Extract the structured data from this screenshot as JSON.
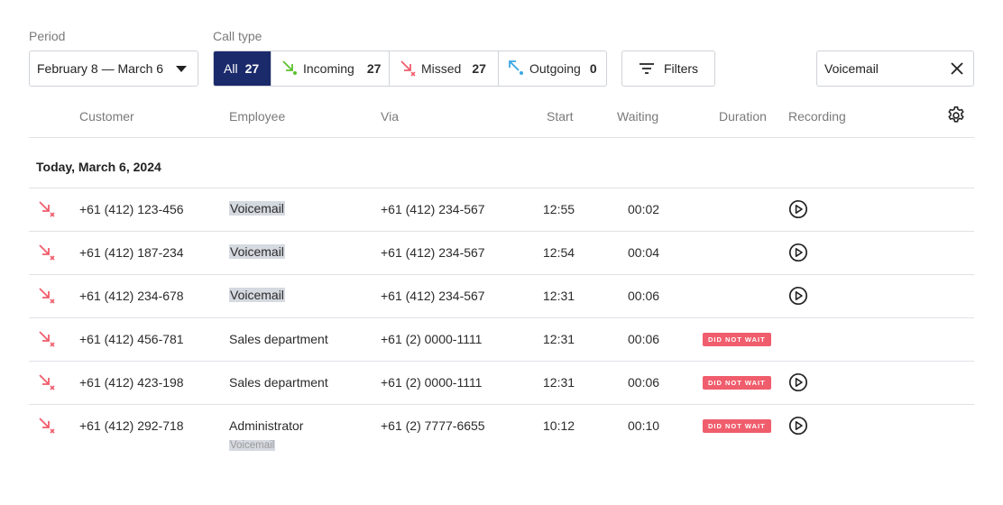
{
  "filters": {
    "period_label": "Period",
    "period_value": "February 8 — March 6",
    "call_type_label": "Call type",
    "call_types": [
      {
        "label": "All",
        "count": "27",
        "active": true,
        "icon": null
      },
      {
        "label": "Incoming",
        "count": "27",
        "active": false,
        "icon": "incoming-call-icon"
      },
      {
        "label": "Missed",
        "count": "27",
        "active": false,
        "icon": "missed-call-icon"
      },
      {
        "label": "Outgoing",
        "count": "0",
        "active": false,
        "icon": "outgoing-call-icon"
      }
    ],
    "filters_button": "Filters",
    "search_value": "Voicemail"
  },
  "table": {
    "headers": {
      "customer": "Customer",
      "employee": "Employee",
      "via": "Via",
      "start": "Start",
      "waiting": "Waiting",
      "duration": "Duration",
      "recording": "Recording"
    },
    "day_title": "Today, March 6, 2024",
    "rows": [
      {
        "customer": "+61 (412) 123-456",
        "employee": "Voicemail",
        "via": "+61 (412) 234-567",
        "start": "12:55",
        "waiting": "00:02",
        "badge": "",
        "recording": true
      },
      {
        "customer": "+61 (412) 187-234",
        "employee": "Voicemail",
        "via": "+61 (412) 234-567",
        "start": "12:54",
        "waiting": "00:04",
        "badge": "",
        "recording": true
      },
      {
        "customer": "+61 (412) 234-678",
        "employee": "Voicemail",
        "via": "+61 (412) 234-567",
        "start": "12:31",
        "waiting": "00:06",
        "badge": "",
        "recording": true
      },
      {
        "customer": "+61 (412) 456-781",
        "employee": "Sales department",
        "via": "+61 (2) 0000-1111",
        "start": "12:31",
        "waiting": "00:06",
        "badge": "DID NOT WAIT",
        "recording": false
      },
      {
        "customer": "+61 (412) 423-198",
        "employee": "Sales department",
        "via": "+61 (2) 0000-1111",
        "start": "12:31",
        "waiting": "00:06",
        "badge": "DID NOT WAIT",
        "recording": true
      },
      {
        "customer": "+61 (412) 292-718",
        "employee": "Administrator",
        "employee_sub": "Voicemail",
        "via": "+61 (2) 7777-6655",
        "start": "10:12",
        "waiting": "00:10",
        "badge": "DID NOT WAIT",
        "recording": true
      }
    ]
  },
  "colors": {
    "accent": "#1b2a6b",
    "missed": "#f05d6c",
    "incoming": "#5cc22f",
    "outgoing": "#3aa6e6",
    "badge": "#f05d6c",
    "highlight": "#d5d9e0"
  }
}
